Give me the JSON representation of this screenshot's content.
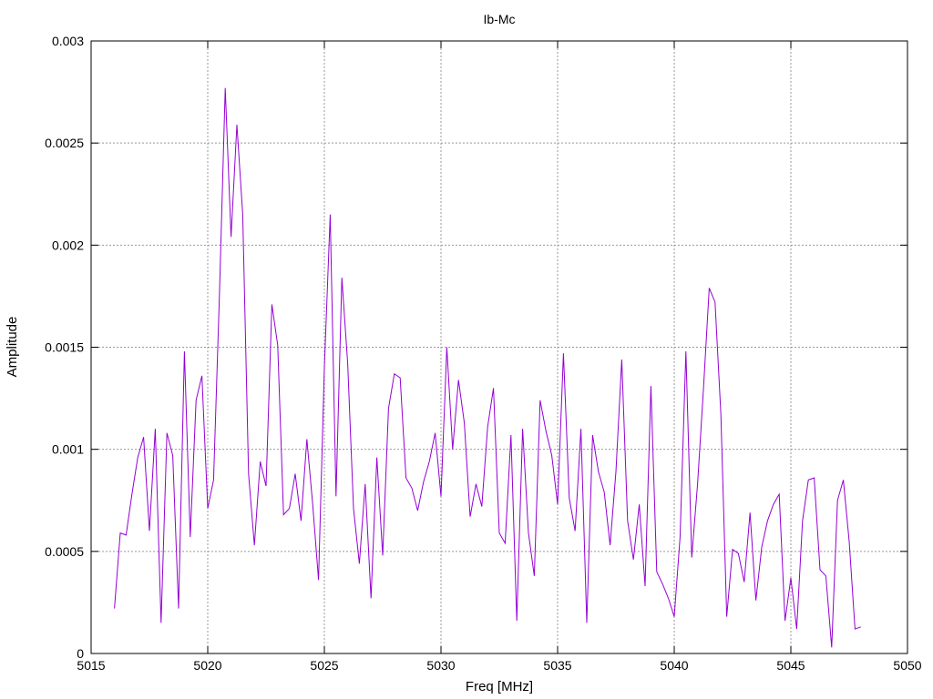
{
  "chart_data": {
    "type": "line",
    "title": "Ib-Mc",
    "xlabel": "Freq [MHz]",
    "ylabel": "Amplitude",
    "xlim": [
      5015,
      5050
    ],
    "ylim": [
      0,
      0.003
    ],
    "grid": true,
    "xticks": [
      5015,
      5020,
      5025,
      5030,
      5035,
      5040,
      5045,
      5050
    ],
    "yticks": [
      0,
      0.0005,
      0.001,
      0.0015,
      0.002,
      0.0025,
      0.003
    ],
    "xtick_labels": [
      "5015",
      "5020",
      "5025",
      "5030",
      "5035",
      "5040",
      "5045",
      "5050"
    ],
    "ytick_labels": [
      "0",
      "0.0005",
      "0.001",
      "0.0015",
      "0.002",
      "0.0025",
      "0.003"
    ],
    "series": [
      {
        "color": "#9400d3",
        "x": [
          5016.0,
          5016.25,
          5016.5,
          5016.75,
          5017.0,
          5017.25,
          5017.5,
          5017.75,
          5018.0,
          5018.25,
          5018.5,
          5018.75,
          5019.0,
          5019.25,
          5019.5,
          5019.75,
          5020.0,
          5020.25,
          5020.5,
          5020.75,
          5021.0,
          5021.25,
          5021.5,
          5021.75,
          5022.0,
          5022.25,
          5022.5,
          5022.75,
          5023.0,
          5023.25,
          5023.5,
          5023.75,
          5024.0,
          5024.25,
          5024.5,
          5024.75,
          5025.0,
          5025.25,
          5025.5,
          5025.75,
          5026.0,
          5026.25,
          5026.5,
          5026.75,
          5027.0,
          5027.25,
          5027.5,
          5027.75,
          5028.0,
          5028.25,
          5028.5,
          5028.75,
          5029.0,
          5029.25,
          5029.5,
          5029.75,
          5030.0,
          5030.25,
          5030.5,
          5030.75,
          5031.0,
          5031.25,
          5031.5,
          5031.75,
          5032.0,
          5032.25,
          5032.5,
          5032.75,
          5033.0,
          5033.25,
          5033.5,
          5033.75,
          5034.0,
          5034.25,
          5034.5,
          5034.75,
          5035.0,
          5035.25,
          5035.5,
          5035.75,
          5036.0,
          5036.25,
          5036.5,
          5036.75,
          5037.0,
          5037.25,
          5037.5,
          5037.75,
          5038.0,
          5038.25,
          5038.5,
          5038.75,
          5039.0,
          5039.25,
          5039.5,
          5039.75,
          5040.0,
          5040.25,
          5040.5,
          5040.75,
          5041.0,
          5041.25,
          5041.5,
          5041.75,
          5042.0,
          5042.25,
          5042.5,
          5042.75,
          5043.0,
          5043.25,
          5043.5,
          5043.75,
          5044.0,
          5044.25,
          5044.5,
          5044.75,
          5045.0,
          5045.25,
          5045.5,
          5045.75,
          5046.0,
          5046.25,
          5046.5,
          5046.75,
          5047.0,
          5047.25,
          5047.5,
          5047.75,
          5048.0
        ],
        "y": [
          0.00022,
          0.00059,
          0.00058,
          0.00078,
          0.00096,
          0.00106,
          0.0006,
          0.0011,
          0.00015,
          0.00108,
          0.00097,
          0.00022,
          0.00148,
          0.00057,
          0.00124,
          0.00136,
          0.00071,
          0.00085,
          0.00175,
          0.00277,
          0.00204,
          0.00259,
          0.00215,
          0.00088,
          0.00053,
          0.00094,
          0.00082,
          0.00171,
          0.00151,
          0.00068,
          0.00071,
          0.00088,
          0.00065,
          0.00105,
          0.00073,
          0.00036,
          0.0014,
          0.00215,
          0.00077,
          0.00184,
          0.00142,
          0.00071,
          0.00044,
          0.00083,
          0.00027,
          0.00096,
          0.00048,
          0.0012,
          0.00137,
          0.00135,
          0.00086,
          0.00081,
          0.0007,
          0.00084,
          0.00094,
          0.00108,
          0.00077,
          0.0015,
          0.001,
          0.00134,
          0.00113,
          0.00067,
          0.00083,
          0.00072,
          0.00111,
          0.0013,
          0.00059,
          0.00054,
          0.00107,
          0.00016,
          0.0011,
          0.00059,
          0.00038,
          0.00124,
          0.00109,
          0.00097,
          0.00073,
          0.00147,
          0.00076,
          0.0006,
          0.0011,
          0.00015,
          0.00107,
          0.00089,
          0.00079,
          0.00053,
          0.00089,
          0.00144,
          0.00065,
          0.00046,
          0.00073,
          0.00033,
          0.00131,
          0.0004,
          0.00034,
          0.00027,
          0.00018,
          0.00057,
          0.00148,
          0.00047,
          0.00083,
          0.00129,
          0.00179,
          0.00172,
          0.00117,
          0.00018,
          0.00051,
          0.00049,
          0.00035,
          0.00069,
          0.00026,
          0.00052,
          0.00065,
          0.00073,
          0.00078,
          0.00016,
          0.00037,
          0.00012,
          0.00065,
          0.00085,
          0.00086,
          0.00041,
          0.00038,
          3e-05,
          0.00075,
          0.00085,
          0.00055,
          0.00012,
          0.00013
        ]
      }
    ]
  }
}
